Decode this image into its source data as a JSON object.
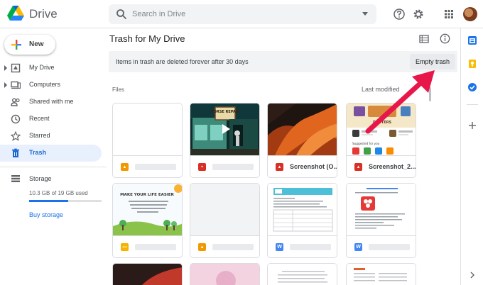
{
  "app": {
    "name": "Drive"
  },
  "search": {
    "placeholder": "Search in Drive"
  },
  "sidebar": {
    "new_label": "New",
    "items": [
      {
        "label": "My Drive",
        "icon": "my-drive-icon",
        "expandable": true
      },
      {
        "label": "Computers",
        "icon": "computer-icon",
        "expandable": true
      },
      {
        "label": "Shared with me",
        "icon": "shared-icon",
        "expandable": false
      },
      {
        "label": "Recent",
        "icon": "clock-icon",
        "expandable": false
      },
      {
        "label": "Starred",
        "icon": "star-icon",
        "expandable": false
      },
      {
        "label": "Trash",
        "icon": "trash-icon",
        "expandable": false,
        "active": true
      }
    ],
    "storage": {
      "title": "Storage",
      "used_text": "10.3 GB of 19 GB used",
      "used_fraction": 0.54,
      "buy_label": "Buy storage"
    }
  },
  "main": {
    "title": "Trash for My Drive",
    "banner_text": "Items in trash are deleted forever after 30 days",
    "empty_trash_label": "Empty trash",
    "section_label": "Files",
    "sort_label": "Last modified",
    "files": [
      {
        "name": "",
        "type": "image",
        "thumb": "blank"
      },
      {
        "name": "",
        "type": "video",
        "thumb": "horse-repair"
      },
      {
        "name": "Screenshot (O...",
        "type": "image",
        "thumb": "orange-abstract"
      },
      {
        "name": "Screenshot_2...",
        "type": "image",
        "thumb": "phone-apps"
      },
      {
        "name": "",
        "type": "slides",
        "thumb": "make-life-easier"
      },
      {
        "name": "",
        "type": "image",
        "thumb": "blank"
      },
      {
        "name": "",
        "type": "word",
        "thumb": "document-table"
      },
      {
        "name": "",
        "type": "word",
        "thumb": "document-logo"
      }
    ],
    "thumb_text": {
      "horse_sign": "HORSE REPAIR",
      "slide_title": "MAKE YOUR LIFE EASIER",
      "slide_body": "Kids are configured by default to make it harder. Don't expect them to make it easy for you. This is the guard design.",
      "phone_suggested": "Suggested for you",
      "phone_dust": "DUSTERS"
    }
  },
  "colors": {
    "accent": "#1a73e8",
    "active_bg": "#e8f0fe",
    "image_type": "#d93025",
    "word_type": "#4285f4",
    "slides_type": "#f4b400",
    "arrow": "#e8174a"
  }
}
